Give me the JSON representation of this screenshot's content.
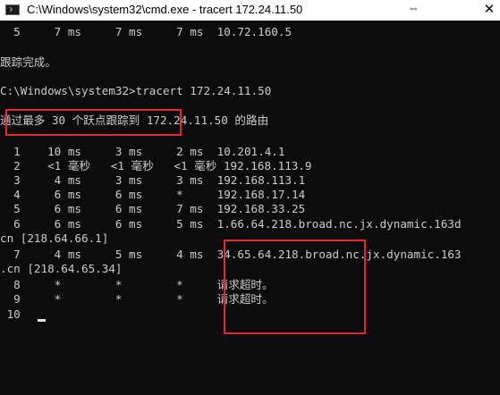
{
  "window": {
    "title": "C:\\Windows\\system32\\cmd.exe - tracert  172.24.11.50",
    "resize_glyph": "⇔",
    "close_glyph": "✕"
  },
  "console": {
    "lines": [
      "  5     7 ms     7 ms     7 ms  10.72.160.5",
      "",
      "跟踪完成。",
      "",
      "C:\\Windows\\system32>tracert 172.24.11.50",
      "",
      "通过最多 30 个跃点跟踪到 172.24.11.50 的路由",
      "",
      "  1    10 ms     3 ms     2 ms  10.201.4.1",
      "  2    <1 毫秒   <1 毫秒   <1 毫秒 192.168.113.9",
      "  3     4 ms     3 ms     3 ms  192.168.113.1",
      "  4     6 ms     6 ms     *     192.168.17.14",
      "  5     6 ms     6 ms     7 ms  192.168.33.25",
      "  6     6 ms     6 ms     5 ms  1.66.64.218.broad.nc.jx.dynamic.163d",
      "cn [218.64.66.1]",
      "  7     4 ms     5 ms     4 ms  34.65.64.218.broad.nc.jx.dynamic.163",
      ".cn [218.64.65.34]",
      "  8     *        *        *     请求超时。",
      "  9     *        *        *     请求超时。",
      " 10  "
    ]
  },
  "highlight_color": "#e02a2a"
}
